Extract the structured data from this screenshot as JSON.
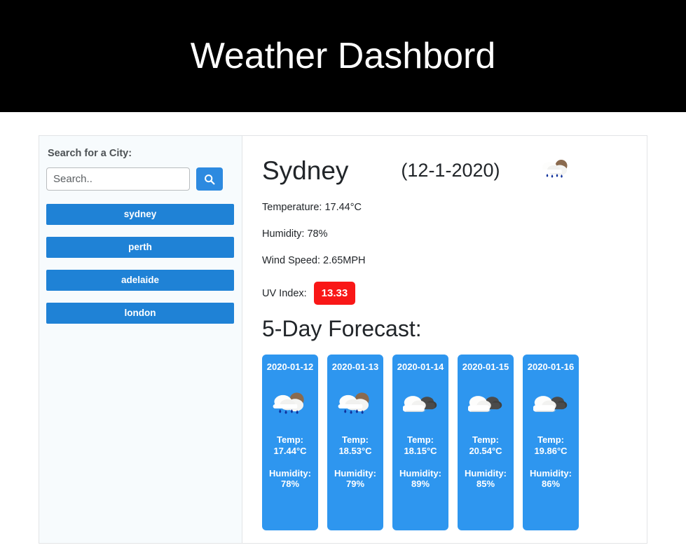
{
  "header": {
    "title": "Weather Dashbord"
  },
  "sidebar": {
    "title": "Search for a City:",
    "search": {
      "placeholder": "Search..",
      "value": "",
      "button_icon": "search-icon"
    },
    "cities": [
      {
        "label": "sydney"
      },
      {
        "label": "perth"
      },
      {
        "label": "adelaide"
      },
      {
        "label": "london"
      }
    ]
  },
  "current": {
    "city": "Sydney",
    "date": "(12-1-2020)",
    "icon": "rain-sun-cloud-icon",
    "temperature": "Temperature: 17.44°C",
    "humidity": "Humidity: 78%",
    "wind": "Wind Speed: 2.65MPH",
    "uv_label": "UV Index:",
    "uv_value": "13.33",
    "uv_color": "#f91717"
  },
  "forecast": {
    "title": "5-Day Forecast:",
    "days": [
      {
        "date": "2020-01-12",
        "icon": "rain-sun-cloud-icon",
        "temp": "Temp: 17.44°C",
        "humidity": "Humidity: 78%"
      },
      {
        "date": "2020-01-13",
        "icon": "rain-sun-cloud-icon",
        "temp": "Temp: 18.53°C",
        "humidity": "Humidity: 79%"
      },
      {
        "date": "2020-01-14",
        "icon": "broken-clouds-icon",
        "temp": "Temp: 18.15°C",
        "humidity": "Humidity: 89%"
      },
      {
        "date": "2020-01-15",
        "icon": "broken-clouds-icon",
        "temp": "Temp: 20.54°C",
        "humidity": "Humidity: 85%"
      },
      {
        "date": "2020-01-16",
        "icon": "broken-clouds-icon",
        "temp": "Temp: 19.86°C",
        "humidity": "Humidity: 86%"
      }
    ]
  },
  "theme": {
    "banner_bg": "#000000",
    "button_blue": "#1f82d6",
    "card_blue": "#2e96ef",
    "sidebar_bg": "#f7fbfd"
  }
}
